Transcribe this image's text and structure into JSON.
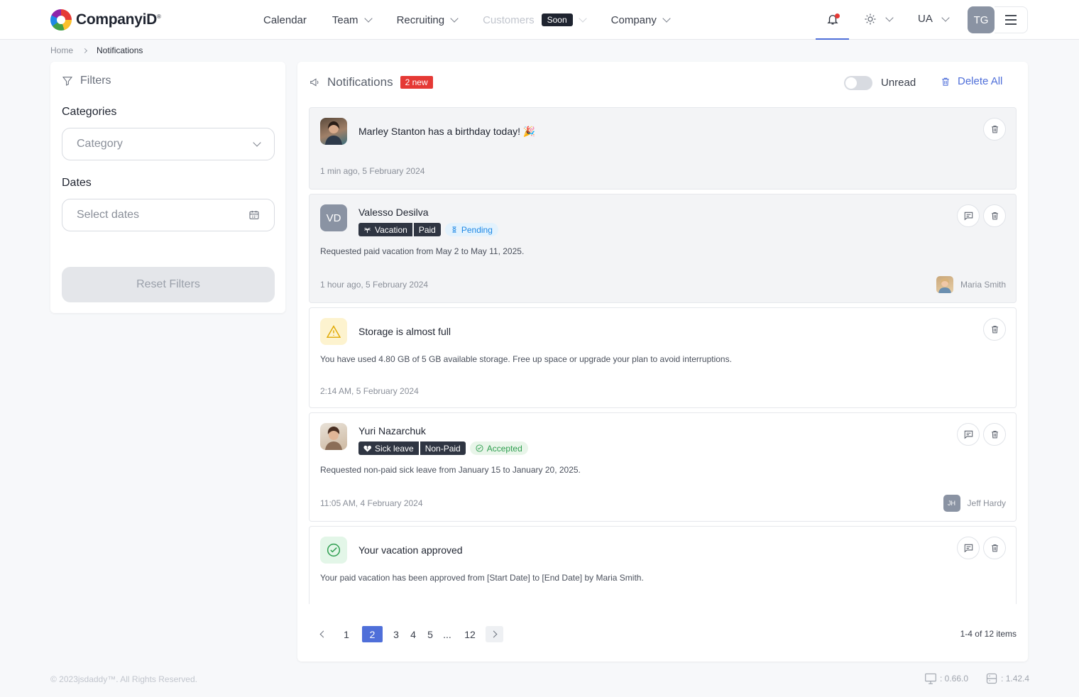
{
  "brand": {
    "name": "CompanyiD",
    "mark": "®"
  },
  "nav": {
    "items": [
      {
        "label": "Calendar",
        "has_dropdown": false
      },
      {
        "label": "Team",
        "has_dropdown": true
      },
      {
        "label": "Recruiting",
        "has_dropdown": true
      },
      {
        "label": "Customers",
        "has_dropdown": true,
        "disabled": true,
        "badge": "Soon"
      },
      {
        "label": "Company",
        "has_dropdown": true
      }
    ],
    "language": "UA",
    "user_initials": "TG"
  },
  "breadcrumb": {
    "home": "Home",
    "current": "Notifications"
  },
  "filters": {
    "title": "Filters",
    "categories_label": "Categories",
    "category_placeholder": "Category",
    "dates_label": "Dates",
    "dates_placeholder": "Select dates",
    "reset_label": "Reset Filters"
  },
  "notifications": {
    "title": "Notifications",
    "new_badge": "2 new",
    "unread_label": "Unread",
    "delete_all_label": "Delete All",
    "items": [
      {
        "title": "Marley Stanton has a birthday today! 🎉",
        "time": "1 min ago, 5 February 2024"
      },
      {
        "title": "Valesso Desilva",
        "initials": "VD",
        "tag_type": "Vacation",
        "tag_pay": "Paid",
        "status": "Pending",
        "desc": "Requested paid vacation from May 2 to May 11, 2025.",
        "time": "1 hour ago, 5 February 2024",
        "approver": "Maria Smith"
      },
      {
        "title": "Storage is almost full",
        "desc": "You have used 4.80 GB of 5 GB available storage. Free up space or upgrade your plan to avoid interruptions.",
        "time": "2:14 AM, 5 February 2024"
      },
      {
        "title": "Yuri Nazarchuk",
        "tag_type": "Sick leave",
        "tag_pay": "Non-Paid",
        "status": "Accepted",
        "desc": "Requested non-paid sick leave from January 15 to January 20, 2025.",
        "time": "11:05 AM, 4 February 2024",
        "approver": "Jeff Hardy",
        "approver_initials": "JH"
      },
      {
        "title": "Your vacation approved",
        "desc": "Your paid vacation has been approved from [Start Date] to [End Date] by Maria Smith."
      }
    ]
  },
  "pagination": {
    "pages": [
      "1",
      "2",
      "3",
      "4",
      "5",
      "...",
      "12"
    ],
    "current": "2",
    "range": "1-4 of 12 items"
  },
  "footer": {
    "copyright": "© 2023jsdaddy™. All Rights Reserved.",
    "client_version": ": 0.66.0",
    "server_version": ": 1.42.4"
  },
  "colors": {
    "accent": "#4f6fd9",
    "danger": "#e53935",
    "success": "#2e9e4f",
    "warning": "#f5b301"
  }
}
